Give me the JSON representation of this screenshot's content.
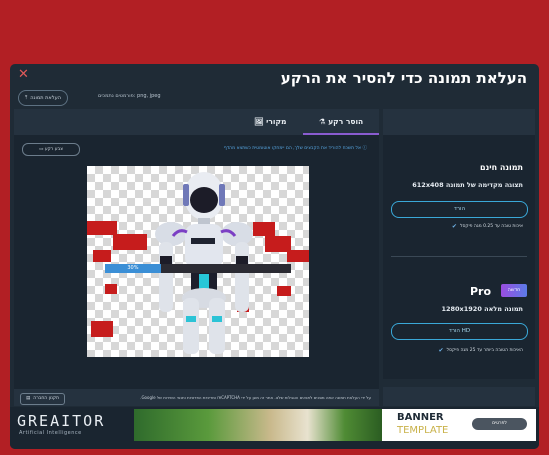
{
  "modal": {
    "title": "העלאת תמונה כדי להסיר את הרקע",
    "upload_button": "העלאת תמונה",
    "formats_text": "פורמטים נתמכים: png, jpeg"
  },
  "tabs": [
    {
      "label": "הוסר רקע"
    },
    {
      "label": "מקורי"
    }
  ],
  "editor": {
    "info_text": "אל תשכח להוריד את הקבצים שלך, הם יימחקו אוטומטית כשתצא מהדף",
    "bg_color_button": "צבע רקע",
    "progress_percent": 30,
    "progress_label": "30%",
    "terms_text": "על ידי העלאת תמונה אתה מסכים לתנאים והגבלות שלנו. אתר זה מוגן על ידי reCAPTCHA ומדיניות הפרטיות ותנאי השירות של Google.",
    "report_button": "תקנון החברה"
  },
  "free": {
    "title": "תמונה חינם",
    "subtitle": "תצוגה מקדימה של תמונה",
    "dims": "612x408",
    "button": "הורד",
    "feature": "איכות טובה עד 0.25 מגה פיקסל"
  },
  "pro": {
    "badge": "חדשה",
    "title": "Pro",
    "subtitle": "תמונה מלאה",
    "dims": "1280x1920",
    "button": "הורד HD",
    "feature": "האיכות הטובה ביותר עד 25 מגה פיקסל"
  },
  "footer": {
    "logo": "GREAITOR",
    "logo_sub": "Artificial Intelligence",
    "banner_line1": "BANNER",
    "banner_line2": "TEMPLATE",
    "banner_button": "לפרטים"
  },
  "colors": {
    "background": "#b21f24",
    "modal": "#1f2b36",
    "accent_purple": "#8a5cd0",
    "accent_blue": "#3aa8d8",
    "progress": "#3b8fd6"
  },
  "icons": [
    "close-icon",
    "upload-icon",
    "magic-icon",
    "image-icon",
    "info-icon",
    "color-swatch-icon",
    "report-icon",
    "check-icon"
  ]
}
